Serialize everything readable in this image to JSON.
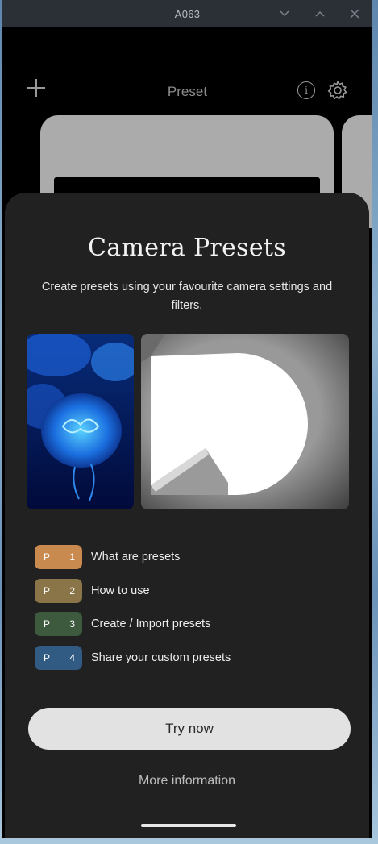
{
  "window": {
    "title": "A063",
    "controls": [
      "chevron-down-icon",
      "chevron-up-icon",
      "close-icon"
    ]
  },
  "header": {
    "title": "Preset",
    "add_icon": "plus-icon",
    "info_icon": "info-icon",
    "settings_icon": "gear-icon",
    "info_glyph": "i"
  },
  "sheet": {
    "title": "Camera Presets",
    "description": "Create presets using your favourite camera settings and filters.",
    "items": [
      {
        "prefix": "P",
        "number": "1",
        "label": "What are presets",
        "color": "#c98a4f"
      },
      {
        "prefix": "P",
        "number": "2",
        "label": "How to use",
        "color": "#8a7548"
      },
      {
        "prefix": "P",
        "number": "3",
        "label": "Create / Import presets",
        "color": "#3d5a3e"
      },
      {
        "prefix": "P",
        "number": "4",
        "label": "Share your custom presets",
        "color": "#315b82"
      }
    ],
    "primary_button": "Try now",
    "secondary_link": "More information"
  },
  "colors": {
    "sheet_bg": "#212121",
    "primary_button_bg": "#e2e2e2",
    "app_bg": "#000000"
  }
}
